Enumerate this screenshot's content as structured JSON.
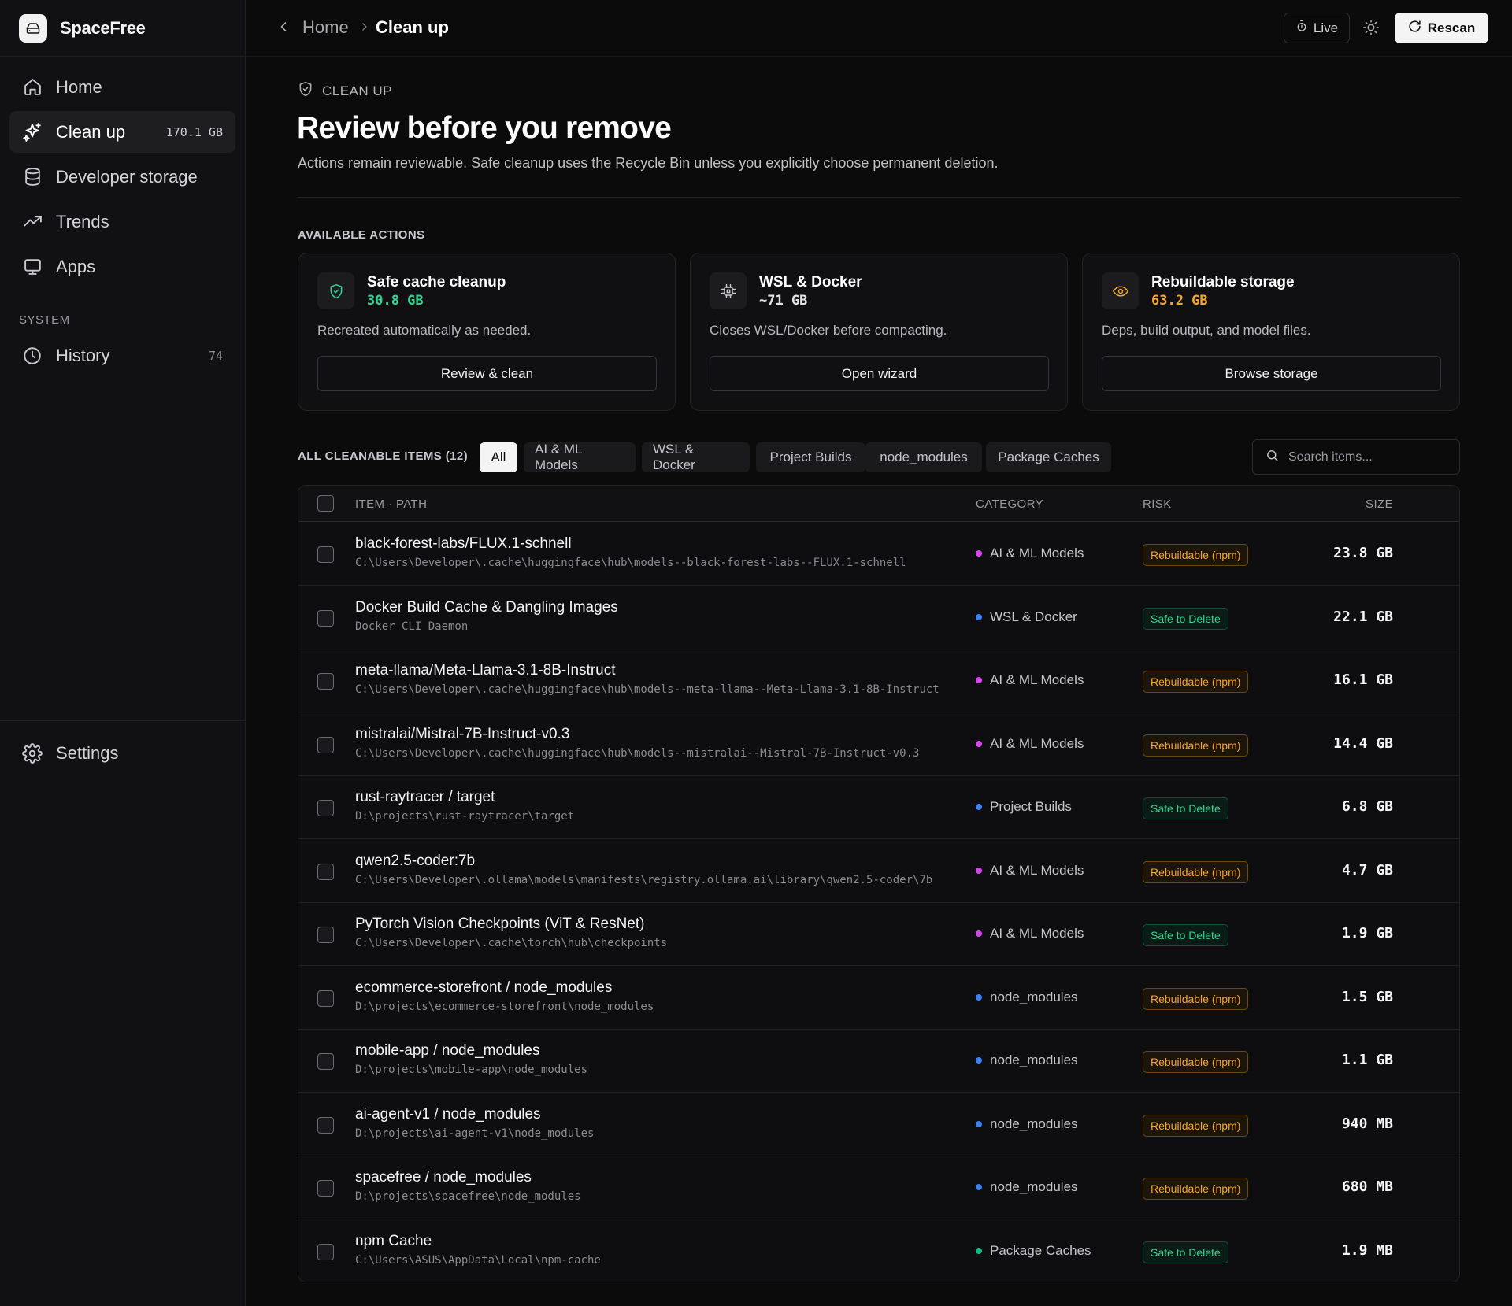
{
  "app": {
    "name": "SpaceFree"
  },
  "sidebar": {
    "items": [
      {
        "label": "Home",
        "icon": "home-icon"
      },
      {
        "label": "Clean up",
        "icon": "sparkle-icon",
        "badge": "170.1 GB"
      },
      {
        "label": "Developer storage",
        "icon": "database-icon"
      },
      {
        "label": "Trends",
        "icon": "trend-up-icon"
      },
      {
        "label": "Apps",
        "icon": "monitor-icon"
      }
    ],
    "section_label": "SYSTEM",
    "history": {
      "label": "History",
      "count": "74"
    },
    "settings": {
      "label": "Settings"
    }
  },
  "header": {
    "breadcrumb_home": "Home",
    "breadcrumb_current": "Clean up",
    "live_label": "Live",
    "rescan_label": "Rescan"
  },
  "page": {
    "eyebrow": "CLEAN UP",
    "title": "Review before you remove",
    "subtitle": "Actions remain reviewable. Safe cleanup uses the Recycle Bin unless you explicitly choose permanent deletion."
  },
  "actions": {
    "section_title": "AVAILABLE ACTIONS",
    "cards": [
      {
        "title": "Safe cache cleanup",
        "amount": "30.8 GB",
        "amount_color": "#2fd392",
        "desc": "Recreated automatically as needed.",
        "button": "Review & clean",
        "icon": "shield-check-icon"
      },
      {
        "title": "WSL & Docker",
        "amount": "~71 GB",
        "amount_color": "#e4e4e7",
        "desc": "Closes WSL/Docker before compacting.",
        "button": "Open wizard",
        "icon": "chip-icon"
      },
      {
        "title": "Rebuildable storage",
        "amount": "63.2 GB",
        "amount_color": "#f4a52b",
        "desc": "Deps, build output, and model files.",
        "button": "Browse storage",
        "icon": "eye-icon"
      }
    ]
  },
  "items_section": {
    "title": "ALL CLEANABLE ITEMS (12)",
    "filters": [
      "All",
      "AI & ML Models",
      "WSL & Docker",
      "Project Builds",
      "node_modules",
      "Package Caches"
    ],
    "search_placeholder": "Search items..."
  },
  "table": {
    "columns": {
      "item": "ITEM · PATH",
      "category": "CATEGORY",
      "risk": "RISK",
      "size": "SIZE"
    },
    "rows": [
      {
        "name": "black-forest-labs/FLUX.1-schnell",
        "path": "C:\\Users\\Developer\\.cache\\huggingface\\hub\\models--black-forest-labs--FLUX.1-schnell",
        "category": "AI & ML Models",
        "dot": "#d946ef",
        "risk": "Rebuildable (npm)",
        "risk_type": "rebuild",
        "size": "23.8 GB"
      },
      {
        "name": "Docker Build Cache & Dangling Images",
        "path": "Docker CLI Daemon",
        "category": "WSL & Docker",
        "dot": "#3b82f6",
        "risk": "Safe to Delete",
        "risk_type": "safe",
        "size": "22.1 GB"
      },
      {
        "name": "meta-llama/Meta-Llama-3.1-8B-Instruct",
        "path": "C:\\Users\\Developer\\.cache\\huggingface\\hub\\models--meta-llama--Meta-Llama-3.1-8B-Instruct",
        "category": "AI & ML Models",
        "dot": "#d946ef",
        "risk": "Rebuildable (npm)",
        "risk_type": "rebuild",
        "size": "16.1 GB"
      },
      {
        "name": "mistralai/Mistral-7B-Instruct-v0.3",
        "path": "C:\\Users\\Developer\\.cache\\huggingface\\hub\\models--mistralai--Mistral-7B-Instruct-v0.3",
        "category": "AI & ML Models",
        "dot": "#d946ef",
        "risk": "Rebuildable (npm)",
        "risk_type": "rebuild",
        "size": "14.4 GB"
      },
      {
        "name": "rust-raytracer / target",
        "path": "D:\\projects\\rust-raytracer\\target",
        "category": "Project Builds",
        "dot": "#3b82f6",
        "risk": "Safe to Delete",
        "risk_type": "safe",
        "size": "6.8 GB"
      },
      {
        "name": "qwen2.5-coder:7b",
        "path": "C:\\Users\\Developer\\.ollama\\models\\manifests\\registry.ollama.ai\\library\\qwen2.5-coder\\7b",
        "category": "AI & ML Models",
        "dot": "#d946ef",
        "risk": "Rebuildable (npm)",
        "risk_type": "rebuild",
        "size": "4.7 GB"
      },
      {
        "name": "PyTorch Vision Checkpoints (ViT & ResNet)",
        "path": "C:\\Users\\Developer\\.cache\\torch\\hub\\checkpoints",
        "category": "AI & ML Models",
        "dot": "#d946ef",
        "risk": "Safe to Delete",
        "risk_type": "safe",
        "size": "1.9 GB"
      },
      {
        "name": "ecommerce-storefront / node_modules",
        "path": "D:\\projects\\ecommerce-storefront\\node_modules",
        "category": "node_modules",
        "dot": "#3b82f6",
        "risk": "Rebuildable (npm)",
        "risk_type": "rebuild",
        "size": "1.5 GB"
      },
      {
        "name": "mobile-app / node_modules",
        "path": "D:\\projects\\mobile-app\\node_modules",
        "category": "node_modules",
        "dot": "#3b82f6",
        "risk": "Rebuildable (npm)",
        "risk_type": "rebuild",
        "size": "1.1 GB"
      },
      {
        "name": "ai-agent-v1 / node_modules",
        "path": "D:\\projects\\ai-agent-v1\\node_modules",
        "category": "node_modules",
        "dot": "#3b82f6",
        "risk": "Rebuildable (npm)",
        "risk_type": "rebuild",
        "size": "940 MB"
      },
      {
        "name": "spacefree / node_modules",
        "path": "D:\\projects\\spacefree\\node_modules",
        "category": "node_modules",
        "dot": "#3b82f6",
        "risk": "Rebuildable (npm)",
        "risk_type": "rebuild",
        "size": "680 MB"
      },
      {
        "name": "npm Cache",
        "path": "C:\\Users\\ASUS\\AppData\\Local\\npm-cache",
        "category": "Package Caches",
        "dot": "#10b981",
        "risk": "Safe to Delete",
        "risk_type": "safe",
        "size": "1.9 MB"
      }
    ]
  }
}
